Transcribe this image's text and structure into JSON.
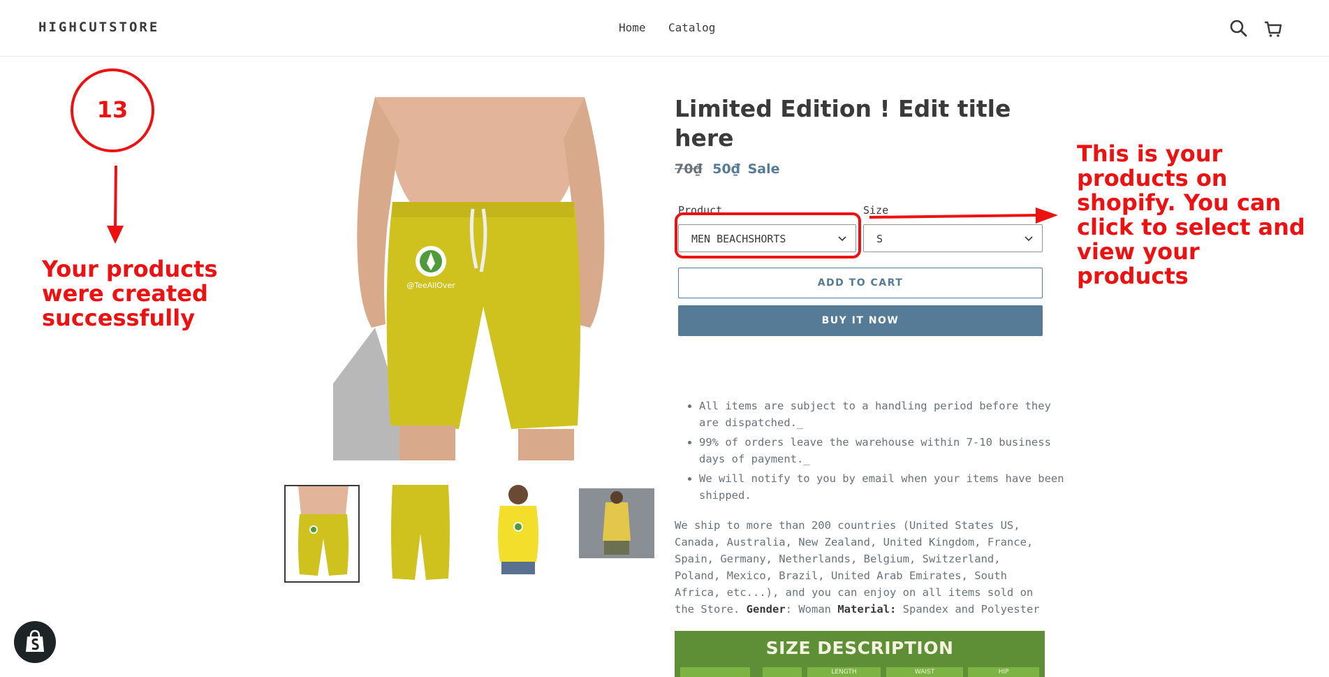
{
  "header": {
    "store_name": "HIGHCUTSTORE",
    "nav": [
      {
        "label": "Home"
      },
      {
        "label": "Catalog"
      }
    ],
    "search_icon": "search-icon",
    "cart_icon": "cart-icon"
  },
  "product": {
    "title": "Limited Edition ! Edit title here",
    "price_old": "70₫",
    "price_new": "50₫",
    "sale_label": "Sale",
    "options": [
      {
        "label": "Product",
        "value": "MEN BEACHSHORTS"
      },
      {
        "label": "Size",
        "value": "S"
      }
    ],
    "add_to_cart": "ADD TO CART",
    "buy_now": "BUY IT NOW",
    "bullets": [
      "All items are subject to a handling period before they are dispatched._",
      "99% of orders leave the warehouse within 7-10 business days of payment._",
      "We will notify to you by email when your items have been shipped."
    ],
    "description": {
      "text": "We ship to more than 200 countries (United States US, Canada, Australia, New Zealand, United Kingdom, France, Spain, Germany, Netherlands, Belgium, Switzerland, Poland, Mexico, Brazil, United Arab Emirates, South Africa, etc...), and you can enjoy on all items sold on the Store.",
      "gender_label": "Gender",
      "gender_value": ": Woman",
      "material_label": "Material:",
      "material_value": " Spandex and Polyester"
    },
    "size_banner": {
      "title": "SIZE DESCRIPTION",
      "columns": [
        "",
        "",
        "LENGTH",
        "WAIST",
        "HIP"
      ]
    },
    "thumbnails": [
      "Men beachshorts front",
      "Men beachshorts back",
      "Women tank top front",
      "Women tank top back"
    ],
    "logo_text": "@TeeAllOver"
  },
  "annotations": {
    "step_number": "13",
    "left_note": "Your products were created successfully",
    "right_note": "This is your products on shopify. You can click to select and view your products"
  },
  "colors": {
    "accent": "#557b97",
    "annotation_red": "#ee1111",
    "shorts_yellow": "#cfc21f",
    "banner_green": "#5e8f37"
  }
}
